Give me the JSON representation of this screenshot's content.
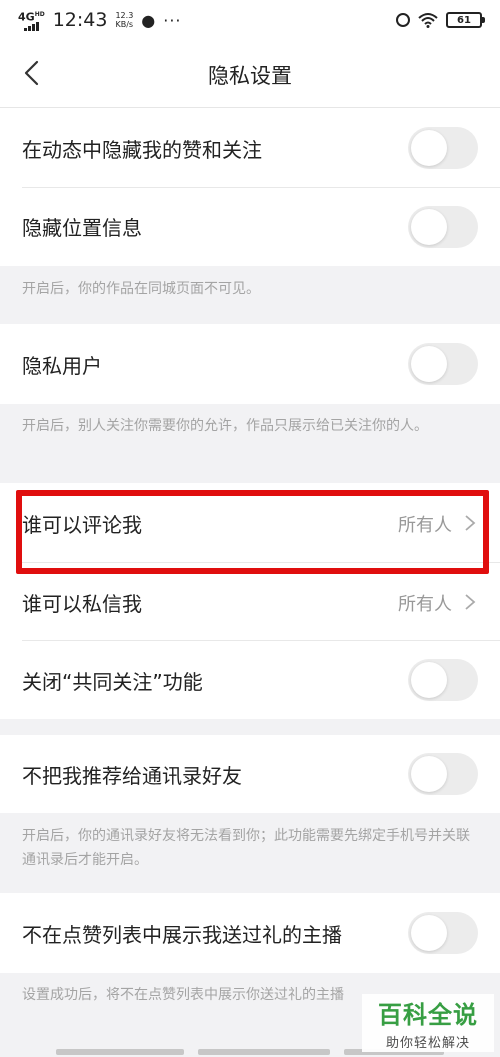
{
  "status_bar": {
    "network": "4G",
    "network_sup": "HD",
    "time": "12:43",
    "speed_value": "12.3",
    "speed_unit": "KB/s",
    "more": "···",
    "battery": "61"
  },
  "header": {
    "title": "隐私设置"
  },
  "rows": [
    {
      "label": "在动态中隐藏我的赞和关注",
      "type": "toggle",
      "on": false
    },
    {
      "label": "隐藏位置信息",
      "type": "toggle",
      "on": false
    },
    {
      "label": "隐私用户",
      "type": "toggle",
      "on": false
    },
    {
      "label": "谁可以评论我",
      "type": "select",
      "value": "所有人"
    },
    {
      "label": "谁可以私信我",
      "type": "select",
      "value": "所有人"
    },
    {
      "label": "关闭“共同关注”功能",
      "type": "toggle",
      "on": false
    },
    {
      "label": "不把我推荐给通讯录好友",
      "type": "toggle",
      "on": false
    },
    {
      "label": "不在点赞列表中展示我送过礼的主播",
      "type": "toggle",
      "on": false
    }
  ],
  "notes": {
    "location": "开启后，你的作品在同城页面不可见。",
    "private_user": "开启后，别人关注你需要你的允许，作品只展示给已关注你的人。",
    "contacts": "开启后，你的通讯录好友将无法看到你；此功能需要先绑定手机号并关联通讯录后才能开启。",
    "gift": "设置成功后，将不在点赞列表中展示你送过礼的主播"
  },
  "watermark": {
    "title": "百科全说",
    "subtitle": "助你轻松解决"
  },
  "colors": {
    "highlight_border": "#e00e0e",
    "toggle_off": "#ececec",
    "watermark_green": "#2e9a3a"
  }
}
